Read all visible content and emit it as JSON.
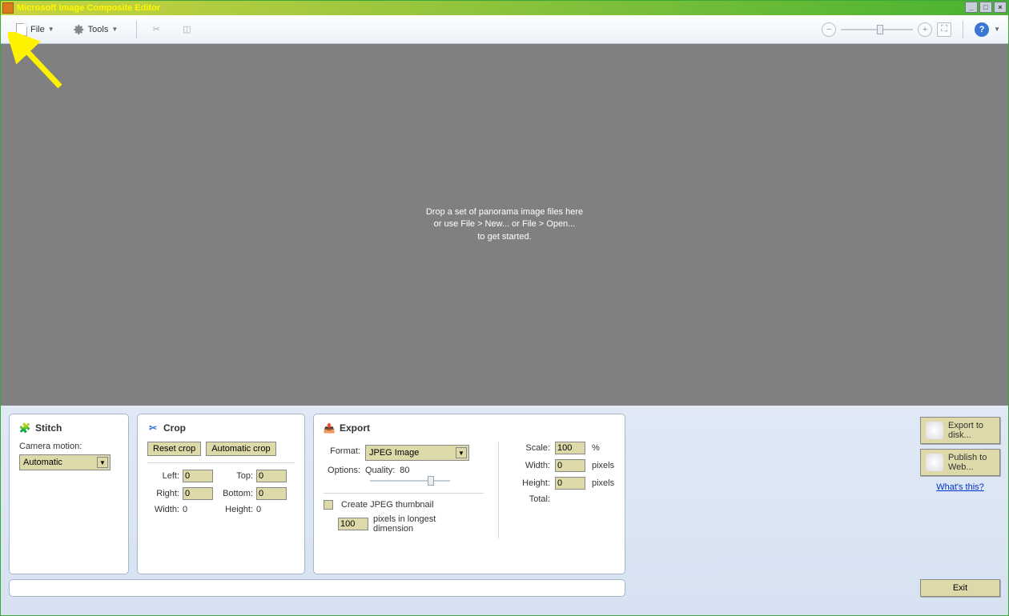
{
  "titlebar": {
    "title": "Microsoft Image Composite Editor"
  },
  "toolbar": {
    "file": "File",
    "tools": "Tools"
  },
  "canvas": {
    "line1": "Drop a set of panorama image files here",
    "line2": "or use File > New... or File > Open...",
    "line3": "to get started."
  },
  "stitch": {
    "title": "Stitch",
    "camera_label": "Camera motion:",
    "camera_value": "Automatic"
  },
  "crop": {
    "title": "Crop",
    "reset": "Reset crop",
    "auto": "Automatic crop",
    "left_lbl": "Left:",
    "left_val": "0",
    "top_lbl": "Top:",
    "top_val": "0",
    "right_lbl": "Right:",
    "right_val": "0",
    "bottom_lbl": "Bottom:",
    "bottom_val": "0",
    "width_lbl": "Width:",
    "width_val": "0",
    "height_lbl": "Height:",
    "height_val": "0"
  },
  "export": {
    "title": "Export",
    "format_lbl": "Format:",
    "format_val": "JPEG Image",
    "options_lbl": "Options:",
    "quality_lbl": "Quality:",
    "quality_val": "80",
    "thumb_lbl": "Create JPEG thumbnail",
    "thumb_px": "100",
    "thumb_unit": "pixels in longest dimension",
    "scale_lbl": "Scale:",
    "scale_val": "100",
    "scale_unit": "%",
    "width_lbl": "Width:",
    "width_val": "0",
    "px": "pixels",
    "height_lbl": "Height:",
    "height_val": "0",
    "total_lbl": "Total:"
  },
  "side": {
    "disk": "Export to disk...",
    "web": "Publish to Web...",
    "whats": "What's this?"
  },
  "footer": {
    "exit": "Exit"
  }
}
